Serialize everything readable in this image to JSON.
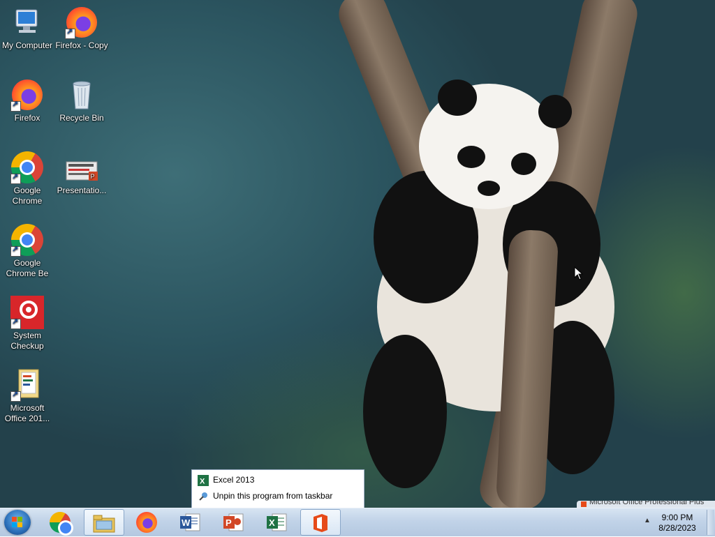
{
  "desktop": {
    "icons": [
      {
        "label": "My Computer",
        "icon": "computer-icon"
      },
      {
        "label": "Firefox - Copy",
        "icon": "firefox-icon"
      },
      {
        "label": "Firefox",
        "icon": "firefox-icon"
      },
      {
        "label": "Recycle Bin",
        "icon": "recycle-bin-icon"
      },
      {
        "label": "Google Chrome",
        "icon": "chrome-icon"
      },
      {
        "label": "Presentatio...",
        "icon": "powerpoint-file-icon"
      },
      {
        "label": "Google Chrome Be",
        "icon": "chrome-icon"
      },
      {
        "label": "System Checkup",
        "icon": "system-checkup-icon"
      },
      {
        "label": "Microsoft Office 201...",
        "icon": "office-folder-icon"
      }
    ]
  },
  "jumplist": {
    "items": [
      {
        "label": "Excel 2013",
        "icon": "excel-icon"
      },
      {
        "label": "Unpin this program from taskbar",
        "icon": "unpin-icon"
      }
    ]
  },
  "taskbar": {
    "pinned": [
      "chrome-icon",
      "explorer-icon",
      "firefox-icon",
      "word-icon",
      "powerpoint-icon",
      "excel-icon",
      "office-icon"
    ],
    "clock": {
      "time": "9:00 PM",
      "date": "8/28/2023"
    }
  },
  "notification": {
    "text": "Microsoft Office Professional Plus"
  },
  "colors": {
    "taskbar": "#c1d3e8",
    "excel": "#1f7244",
    "word": "#2b579a",
    "powerpoint": "#d24726",
    "office": "#e64a19"
  }
}
